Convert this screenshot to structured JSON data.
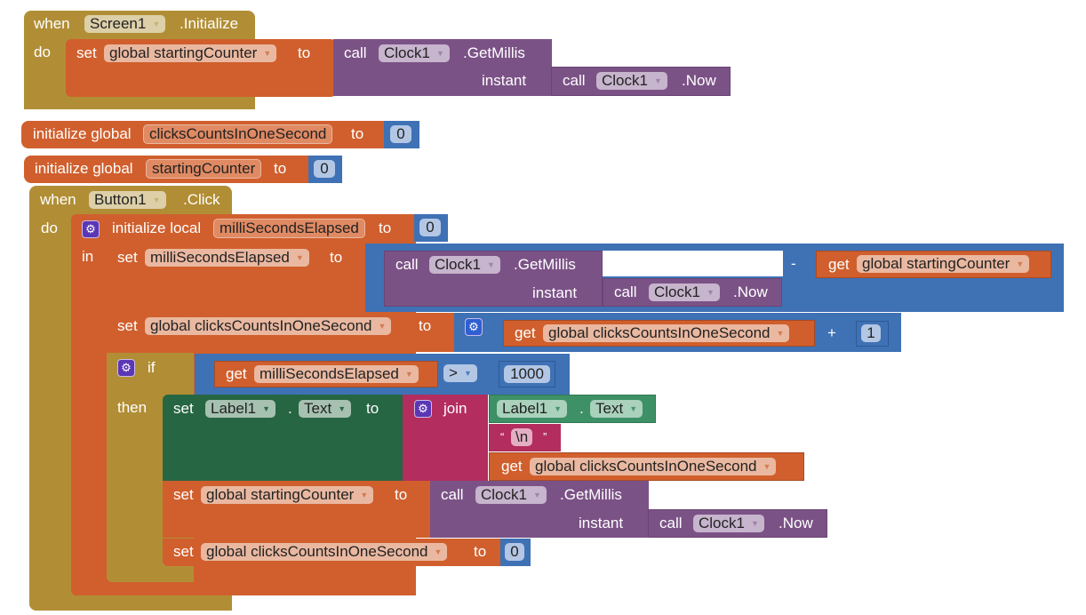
{
  "workspace": {
    "screen_init": {
      "when": "when",
      "component": "Screen1",
      "event": ".Initialize",
      "do": "do",
      "set": "set",
      "variable": "global startingCounter",
      "to": "to",
      "call": "call",
      "clock": "Clock1",
      "method": ".GetMillis",
      "instant": "instant",
      "call2": "call",
      "clock2": "Clock1",
      "method2": ".Now"
    },
    "init_clicks": {
      "label": "initialize global",
      "name": "clicksCountsInOneSecond",
      "to": "to",
      "value": "0"
    },
    "init_counter": {
      "label": "initialize global",
      "name": "startingCounter",
      "to": "to",
      "value": "0"
    },
    "button_click": {
      "when": "when",
      "component": "Button1",
      "event": ".Click",
      "do": "do",
      "local_init": "initialize local",
      "local_name": "milliSecondsElapsed",
      "local_to": "to",
      "local_value": "0",
      "in": "in",
      "set1": {
        "set": "set",
        "variable": "milliSecondsElapsed",
        "to": "to",
        "call": "call",
        "clock": "Clock1",
        "method": ".GetMillis",
        "instant": "instant",
        "call2": "call",
        "clock2": "Clock1",
        "method2": ".Now",
        "operator": "-",
        "get": "get",
        "get_variable": "global startingCounter"
      },
      "set2": {
        "set": "set",
        "variable": "global clicksCountsInOneSecond",
        "to": "to",
        "get": "get",
        "get_variable": "global clicksCountsInOneSecond",
        "operator": "+",
        "value": "1"
      },
      "if_block": {
        "if": "if",
        "get": "get",
        "get_variable": "milliSecondsElapsed",
        "compare": ">",
        "value": "1000",
        "then": "then"
      },
      "set_label": {
        "set": "set",
        "component": "Label1",
        "dot": ".",
        "property": "Text",
        "to": "to",
        "join": "join",
        "join_component": "Label1",
        "join_dot": ".",
        "join_property": "Text",
        "open_quote": "“",
        "string": "\\n",
        "close_quote": "”",
        "get": "get",
        "get_variable": "global clicksCountsInOneSecond"
      },
      "set3": {
        "set": "set",
        "variable": "global startingCounter",
        "to": "to",
        "call": "call",
        "clock": "Clock1",
        "method": ".GetMillis",
        "instant": "instant",
        "call2": "call",
        "clock2": "Clock1",
        "method2": ".Now"
      },
      "set4": {
        "set": "set",
        "variable": "global clicksCountsInOneSecond",
        "to": "to",
        "value": "0"
      }
    }
  },
  "icons": {
    "dropdown_arrow": "▼",
    "mutator_gear": "⚙"
  }
}
